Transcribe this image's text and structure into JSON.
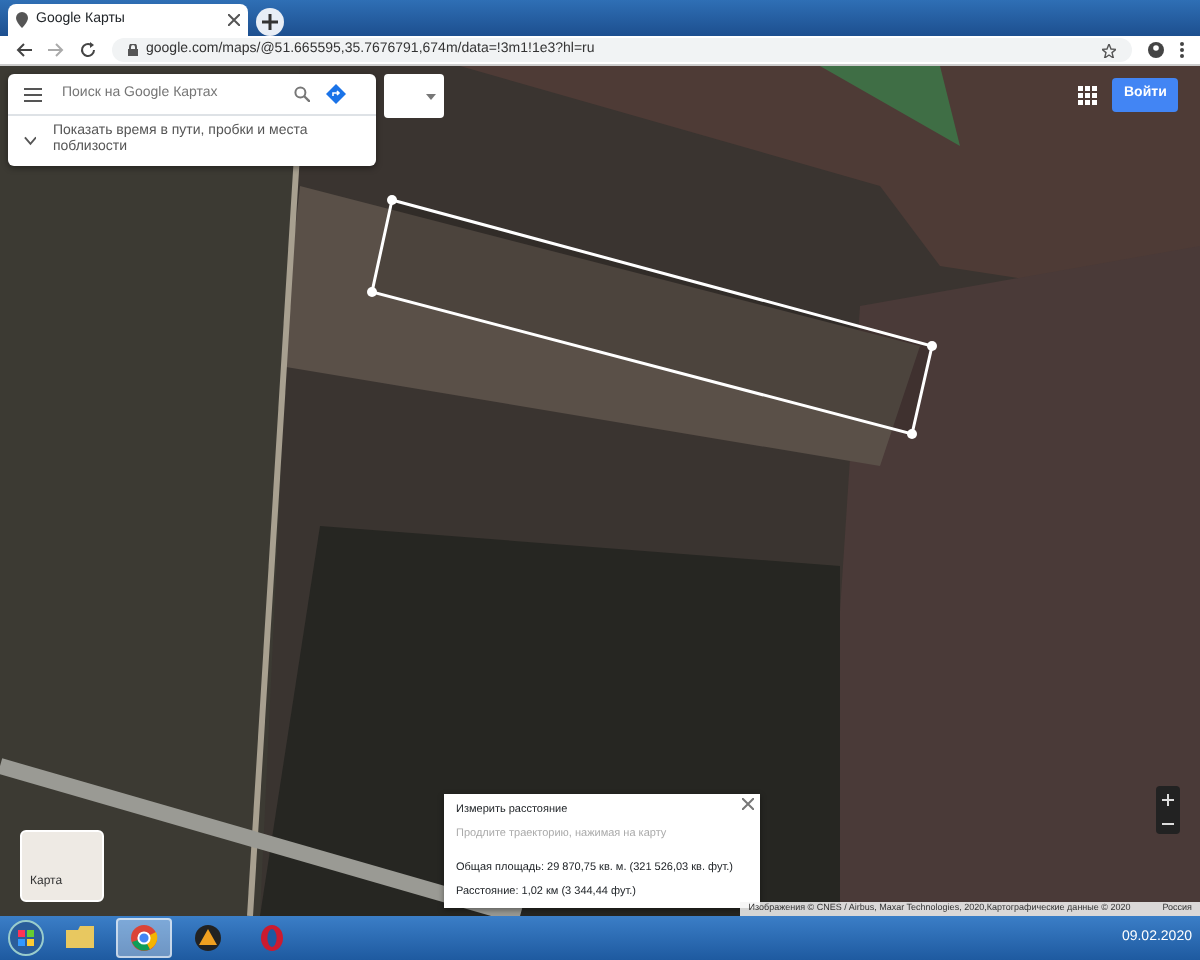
{
  "browser": {
    "tab_title": "Google Карты",
    "url": "google.com/maps/@51.665595,35.7676791,674m/data=!3m1!1e3?hl=ru"
  },
  "search": {
    "placeholder": "Поиск на Google Картах"
  },
  "traffic_hint": "Показать время в пути, пробки и места поблизости",
  "sign_in": "Войти",
  "layer_thumb": "Карта",
  "measure": {
    "title": "Измерить расстояние",
    "hint": "Продлите траекторию, нажимая на карту",
    "area": "Общая площадь: 29 870,75 кв. м. (321 526,03 кв. фут.)",
    "distance": "Расстояние: 1,02 км (3 344,44 фут.)"
  },
  "attribution": [
    "Изображения © CNES / Airbus, Maxar Technologies, 2020,Картографические данные © 2020",
    "Россия"
  ],
  "taskbar": {
    "apps": [
      {
        "kind": "explorer",
        "selected": false
      },
      {
        "kind": "chrome",
        "selected": true
      },
      {
        "kind": "player",
        "selected": false
      },
      {
        "kind": "opera",
        "selected": false
      }
    ],
    "date": "09.02.2020"
  }
}
